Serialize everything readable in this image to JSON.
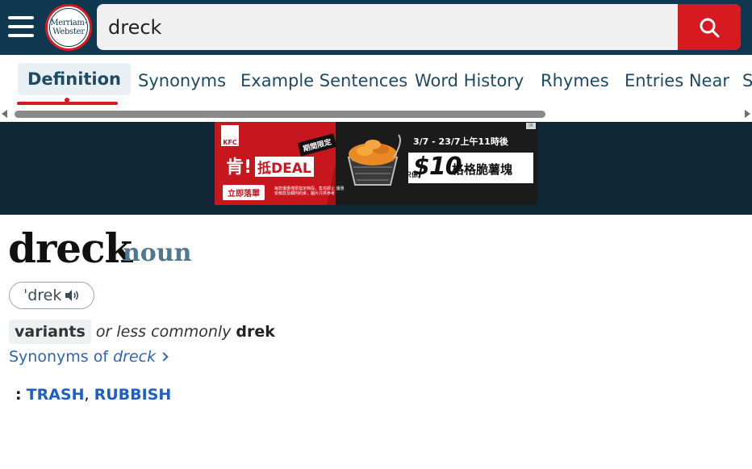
{
  "header": {
    "logo_line1": "Merriam-",
    "logo_line2": "Webster",
    "search_value": "dreck",
    "search_icon": "search-icon",
    "menu_icon": "hamburger-menu-icon"
  },
  "tabs": [
    {
      "label": "Definition",
      "active": true
    },
    {
      "label": "Synonyms"
    },
    {
      "label": "Example Sentences"
    },
    {
      "label": "Word History"
    },
    {
      "label": "Rhymes"
    },
    {
      "label": "Entries Near"
    },
    {
      "label": "S"
    }
  ],
  "ad": {
    "brand": "KFC",
    "date": "3/7 - 23/7上午11時後",
    "headline_prefix": "肯!",
    "headline_deal": "抵DEAL",
    "badge": "期間限定",
    "price": "$10",
    "price_note": "只係",
    "product": "格格脆薯塊",
    "button": "立即落單",
    "fine_print": "每款優惠僅限指定時段，售完即止 優惠受條款及細則約束，圖片只供參考",
    "close": "iX"
  },
  "entry": {
    "headword": "dreck",
    "pos": "noun",
    "pronunciation": "ˈdrek",
    "variants_label": "variants",
    "variants_conj": "or less commonly",
    "variants_word": "drek",
    "synonyms_prefix": "Synonyms of ",
    "synonyms_word": "dreck",
    "def_colon": ":",
    "def_links": [
      "TRASH",
      "RUBBISH"
    ],
    "def_sep": ", "
  },
  "colors": {
    "header_bg": "#0f3850",
    "accent_red": "#d71920",
    "link_blue": "#1d5fc7",
    "pos_color": "#4f7891"
  }
}
